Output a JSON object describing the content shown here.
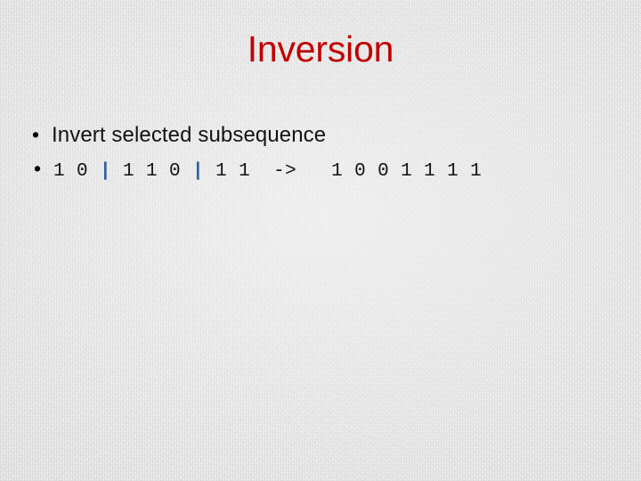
{
  "slide": {
    "title": "Inversion",
    "title_color": "#c00000",
    "background_color": "#efeeee",
    "body_text_color": "#131313",
    "separator_color": "#2f5f9e",
    "bullets": [
      {
        "marker": "•",
        "kind": "text",
        "text": "Invert selected subsequence"
      },
      {
        "marker": "•",
        "kind": "code",
        "text": "1 0 | 1 1 0 | 1 1  ->   1 0 0 1 1 1 1",
        "input_group_1": "1 0 ",
        "separator_1": "|",
        "input_group_2": " 1 1 0 ",
        "separator_2": "|",
        "input_group_3": " 1 1  ",
        "arrow": "->",
        "output": "   1 0 0 1 1 1 1"
      }
    ]
  }
}
